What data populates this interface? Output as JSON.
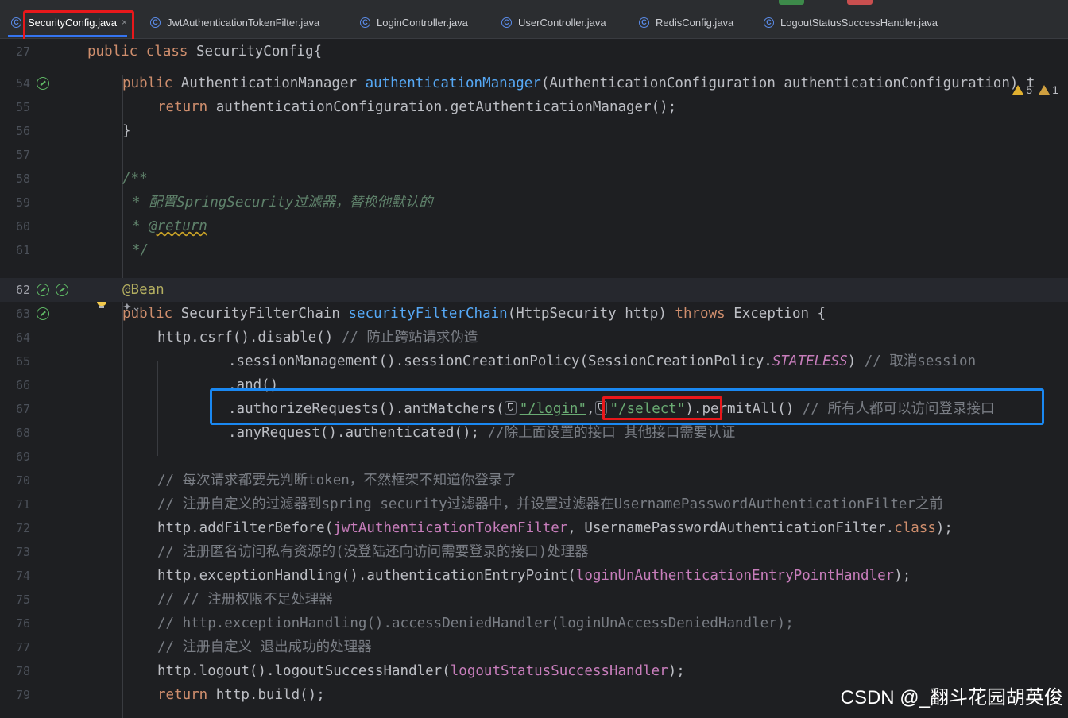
{
  "tabs": [
    {
      "label": "SecurityConfig.java",
      "active": true
    },
    {
      "label": "JwtAuthenticationTokenFilter.java"
    },
    {
      "label": "LoginController.java"
    },
    {
      "label": "UserController.java"
    },
    {
      "label": "RedisConfig.java"
    },
    {
      "label": "LogoutStatusSuccessHandler.java"
    }
  ],
  "close_glyph": "×",
  "class_icon_glyph": "C",
  "inspections": {
    "warnings": "5",
    "weak_warnings": "1"
  },
  "sticky": {
    "line": "27",
    "kw_public": "public",
    "kw_class": "class",
    "name": "SecurityConfig{"
  },
  "lines": {
    "l54": {
      "n": "54",
      "kw": "public",
      "type": "AuthenticationManager",
      "fn": "authenticationManager",
      "rest": "(AuthenticationConfiguration authenticationConfiguration) t"
    },
    "l55": {
      "n": "55",
      "kw": "return",
      "rest": "authenticationConfiguration.getAuthenticationManager();"
    },
    "l56": {
      "n": "56",
      "text": "}"
    },
    "l57": {
      "n": "57"
    },
    "l58": {
      "n": "58",
      "text": "/**"
    },
    "l59": {
      "n": "59",
      "text": "* 配置SpringSecurity过滤器，替换他默认的"
    },
    "l60": {
      "n": "60",
      "star": "* ",
      "tag": "@return"
    },
    "l61": {
      "n": "61",
      "text": "*/"
    },
    "l62": {
      "n": "62",
      "text": "@Bean"
    },
    "l63": {
      "n": "63",
      "kw": "public",
      "type": "SecurityFilterChain",
      "fn": "securityFilterChain",
      "params": "(HttpSecurity http)",
      "throws": "throws",
      "rest": "Exception {"
    },
    "l64": {
      "n": "64",
      "code": "http.csrf().disable()",
      "comment": "// 防止跨站请求伪造"
    },
    "l65": {
      "n": "65",
      "code": ".sessionManagement().sessionCreationPolicy(SessionCreationPolicy.",
      "stat": "STATELESS",
      "close": ")",
      "comment": "// 取消session"
    },
    "l66": {
      "n": "66",
      "code": ".and()"
    },
    "l67": {
      "n": "67",
      "code": ".authorizeRequests().antMatchers(",
      "s1": "\"/login\"",
      "comma": ",",
      "s2": "\"/select\"",
      "close": ")",
      "rest": ".permitAll()",
      "comment": "// 所有人都可以访问登录接口"
    },
    "l68": {
      "n": "68",
      "code": ".anyRequest().authenticated();",
      "comment": "//除上面设置的接口 其他接口需要认证"
    },
    "l69": {
      "n": "69"
    },
    "l70": {
      "n": "70",
      "comment": "// 每次请求都要先判断token，不然框架不知道你登录了"
    },
    "l71": {
      "n": "71",
      "comment": "// 注册自定义的过滤器到spring security过滤器中，并设置过滤器在UsernamePasswordAuthenticationFilter之前"
    },
    "l72": {
      "n": "72",
      "code": "http.addFilterBefore(",
      "fld": "jwtAuthenticationTokenFilter",
      "rest": ", UsernamePasswordAuthenticationFilter.",
      "kw": "class",
      "end": ");"
    },
    "l73": {
      "n": "73",
      "comment": "// 注册匿名访问私有资源的(没登陆还向访问需要登录的接口)处理器"
    },
    "l74": {
      "n": "74",
      "code": "http.exceptionHandling().authenticationEntryPoint(",
      "fld": "loginUnAuthenticationEntryPointHandler",
      "end": ");"
    },
    "l75": {
      "n": "75",
      "comment": "// // 注册权限不足处理器"
    },
    "l76": {
      "n": "76",
      "comment": "// http.exceptionHandling().accessDeniedHandler(loginUnAccessDeniedHandler);"
    },
    "l77": {
      "n": "77",
      "comment": "// 注册自定义 退出成功的处理器"
    },
    "l78": {
      "n": "78",
      "code": "http.logout().logoutSuccessHandler(",
      "fld": "logoutStatusSuccessHandler",
      "end": ");"
    },
    "l79": {
      "n": "79",
      "kw": "return",
      "rest": "http.build();"
    }
  },
  "watermark": "CSDN @_翻斗花园胡英俊",
  "colors": {
    "highlight_red": "#e8181b",
    "highlight_blue": "#1a88f2"
  }
}
